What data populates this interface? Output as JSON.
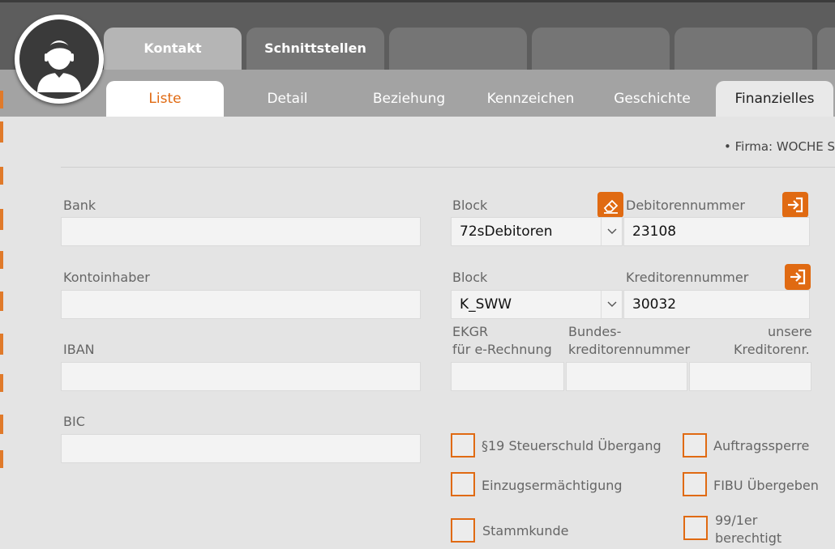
{
  "tabs_main": [
    {
      "label": "Kontakt"
    },
    {
      "label": "Schnittstellen"
    },
    {
      "label": ""
    },
    {
      "label": ""
    },
    {
      "label": ""
    },
    {
      "label": ""
    }
  ],
  "tabs_sub": [
    {
      "label": "Liste"
    },
    {
      "label": "Detail"
    },
    {
      "label": "Beziehung"
    },
    {
      "label": "Kennzeichen"
    },
    {
      "label": "Geschichte"
    },
    {
      "label": "Finanzielles"
    }
  ],
  "header": {
    "firma": "• Firma: WOCHE S"
  },
  "bank": {
    "bank_label": "Bank",
    "bank_value": "",
    "kontoinhaber_label": "Kontoinhaber",
    "kontoinhaber_value": "",
    "iban_label": "IBAN",
    "iban_value": "",
    "bic_label": "BIC",
    "bic_value": ""
  },
  "debitor": {
    "block_label": "Block",
    "block_value": "72sDebitoren",
    "nummer_label": "Debitorennummer",
    "nummer_value": "23108"
  },
  "kreditor": {
    "block_label": "Block",
    "block_value": "K_SWW",
    "nummer_label": "Kreditorennummer",
    "nummer_value": "30032"
  },
  "extra": {
    "ekgr_line1": "EKGR",
    "ekgr_line2": "für e-Rechnung",
    "bundes_line1": "Bundes-",
    "bundes_line2": "kreditorennummer",
    "unsere_line1": "unsere",
    "unsere_line2": "Kreditorenr."
  },
  "checkboxes": {
    "steuerschuld": "§19 Steuerschuld Übergang",
    "auftragssperre": "Auftragssperre",
    "einzug": "Einzugsermächtigung",
    "fibu": "FIBU Übergeben",
    "stammkunde": "Stammkunde",
    "berechtigt_line1": "99/1er",
    "berechtigt_line2": "berechtigt"
  },
  "colors": {
    "accent": "#e06a12",
    "topbar": "#5d5d5d",
    "subbar": "#a3a3a3",
    "background": "#e4e4e4"
  }
}
